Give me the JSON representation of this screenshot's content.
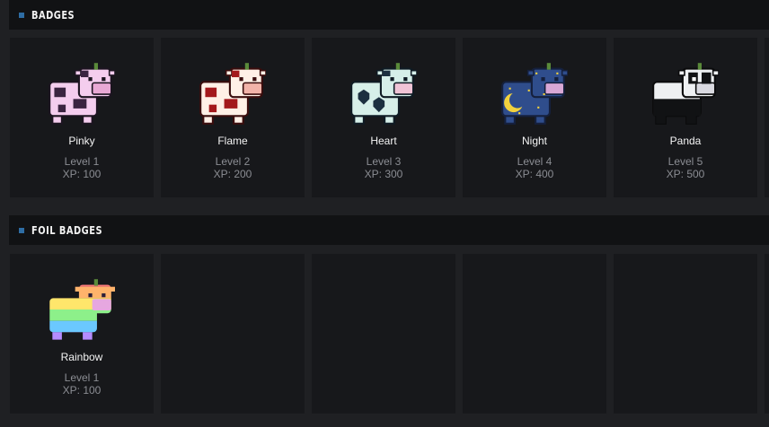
{
  "sections": {
    "badges": {
      "title": "BADGES"
    },
    "foil": {
      "title": "FOIL BADGES"
    }
  },
  "badges": [
    {
      "name": "Pinky",
      "level": "Level 1",
      "xp": "XP: 100",
      "icon": "pinky-cow-icon",
      "colors": {
        "base": "#f4cdee",
        "spot": "#3a2440",
        "outline": "#1c1420",
        "muzzle": "#e9a9d5"
      }
    },
    {
      "name": "Flame",
      "level": "Level 2",
      "xp": "XP: 200",
      "icon": "flame-cow-icon",
      "colors": {
        "base": "#fff0e6",
        "spot": "#a3191c",
        "outline": "#3a0d0d",
        "muzzle": "#f2b3a9"
      }
    },
    {
      "name": "Heart",
      "level": "Level 3",
      "xp": "XP: 300",
      "icon": "heart-cow-icon",
      "colors": {
        "base": "#d6efe9",
        "spot": "#1c3040",
        "outline": "#0f1b24",
        "muzzle": "#f0c4d6"
      }
    },
    {
      "name": "Night",
      "level": "Level 4",
      "xp": "XP: 400",
      "icon": "night-cow-icon",
      "colors": {
        "base": "#2f4d8c",
        "spot": "#f2d23e",
        "outline": "#15203d",
        "muzzle": "#d9a8d6"
      }
    },
    {
      "name": "Panda",
      "level": "Level 5",
      "xp": "XP: 500",
      "icon": "panda-cow-icon",
      "colors": {
        "base": "#eef0f2",
        "spot": "#111214",
        "outline": "#0b0b0c",
        "muzzle": "#d9d9e0"
      }
    }
  ],
  "foil_badges": [
    {
      "name": "Rainbow",
      "level": "Level 1",
      "xp": "XP: 100",
      "icon": "rainbow-cow-icon"
    }
  ]
}
